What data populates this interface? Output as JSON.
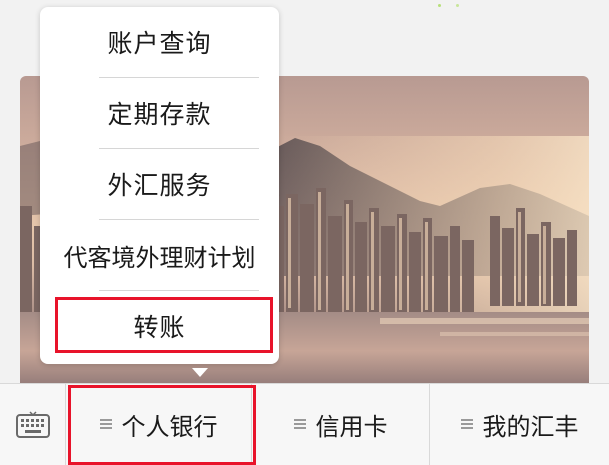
{
  "popup_menu": {
    "items": [
      {
        "label": "账户查询"
      },
      {
        "label": "定期存款"
      },
      {
        "label": "外汇服务"
      },
      {
        "label": "代客境外理财计划"
      },
      {
        "label": "转账"
      }
    ],
    "highlighted_item": "转账"
  },
  "bottom_bar": {
    "keyboard_icon": "keyboard-icon",
    "tabs": [
      {
        "label": "个人银行",
        "icon": "menu-lines-icon"
      },
      {
        "label": "信用卡",
        "icon": "menu-lines-icon"
      },
      {
        "label": "我的汇丰",
        "icon": "menu-lines-icon"
      }
    ],
    "highlighted_tab": "个人银行"
  },
  "banner": {
    "image": "city-skyline-sunset-photo"
  },
  "colors": {
    "highlight": "#e8132a",
    "background": "#f2f2f2",
    "menu_background": "#ffffff",
    "text": "#1a1a1a"
  }
}
